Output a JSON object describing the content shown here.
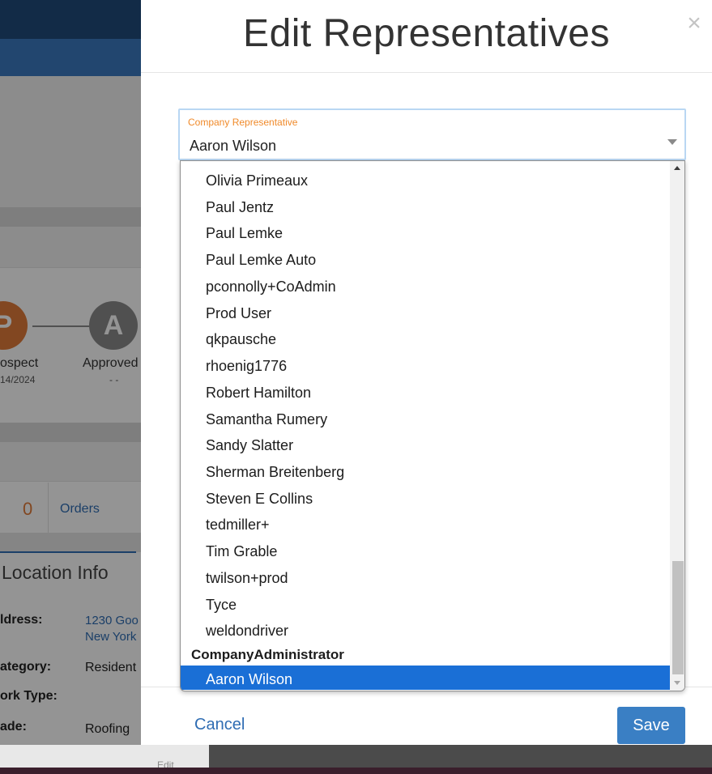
{
  "background": {
    "stepper": [
      {
        "letter": "P",
        "label": "ospect",
        "date": "14/2024",
        "color": "#e07b39"
      },
      {
        "letter": "A",
        "label": "Approved",
        "date": "- -",
        "color": "#8a8a8a"
      }
    ],
    "stats": {
      "count": "0",
      "orders_link": "Orders"
    },
    "location": {
      "title": "Location Info",
      "address_label": "ldress:",
      "address_line1": "1230 Goo",
      "address_line2": "New York",
      "category_label": "ategory:",
      "category_value": "Resident",
      "work_type_label": "ork Type:",
      "trade_label": "ade:",
      "trade_value": "Roofing"
    },
    "bottom_fragment": "Edit"
  },
  "modal": {
    "title": "Edit Representatives",
    "close_glyph": "×",
    "field": {
      "label": "Company Representative",
      "value": "Aaron Wilson"
    },
    "options": [
      "Olivia Primeaux",
      "Paul Jentz",
      "Paul Lemke",
      "Paul Lemke Auto",
      "pconnolly+CoAdmin",
      "Prod User",
      "qkpausche",
      "rhoenig1776",
      "Robert Hamilton",
      "Samantha Rumery",
      "Sandy Slatter",
      "Sherman Breitenberg",
      "Steven E Collins",
      "tedmiller+",
      "Tim Grable",
      "twilson+prod",
      "Tyce",
      "weldondriver"
    ],
    "group_label": "CompanyAdministrator",
    "selected_option": "Aaron Wilson",
    "cancel_label": "Cancel",
    "save_label": "Save",
    "colors": {
      "accent": "#1a6fd6",
      "label_orange": "#f08a2a",
      "save_blue": "#3a7fc4"
    }
  }
}
